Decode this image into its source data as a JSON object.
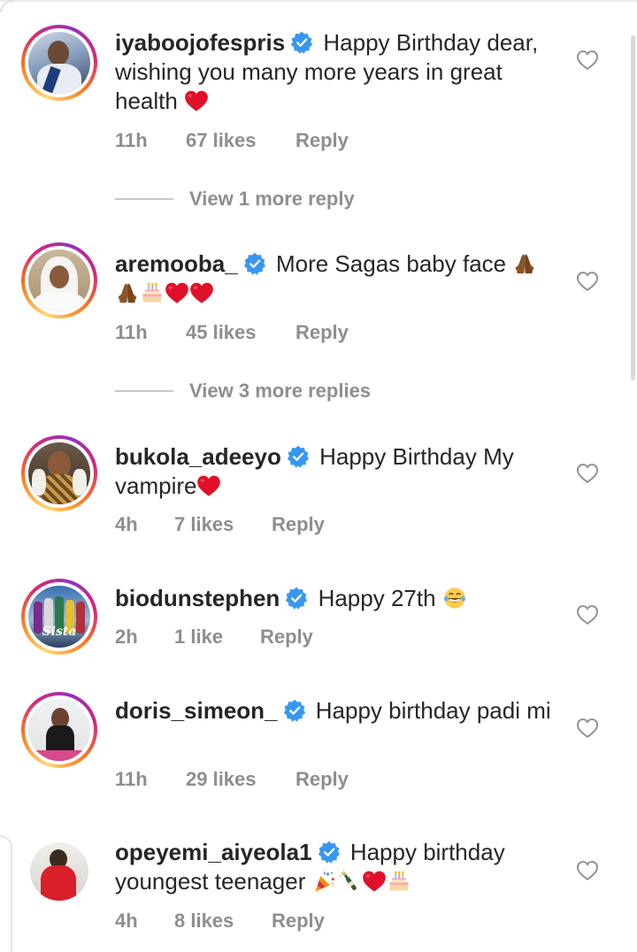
{
  "comments": [
    {
      "username": "iyaboojofespris",
      "text": "Happy Birthday dear, wishing you many more years in great health",
      "emojis": [
        "red-heart"
      ],
      "time": "11h",
      "likes": "67 likes",
      "reply": "Reply",
      "view_replies": "View 1 more reply"
    },
    {
      "username": "aremooba_",
      "text": "More Sagas baby face",
      "emojis": [
        "folded-hands",
        "folded-hands",
        "birthday-cake",
        "red-heart",
        "red-heart"
      ],
      "time": "11h",
      "likes": "45 likes",
      "reply": "Reply",
      "view_replies": "View 3 more replies"
    },
    {
      "username": "bukola_adeeyo",
      "text": "Happy Birthday My vampire",
      "emojis": [
        "red-heart"
      ],
      "time": "4h",
      "likes": "7 likes",
      "reply": "Reply"
    },
    {
      "username": "biodunstephen",
      "text": "Happy 27th",
      "emojis": [
        "face-with-tears-of-joy"
      ],
      "avatar_text": "Sista",
      "time": "2h",
      "likes": "1 like",
      "reply": "Reply"
    },
    {
      "username": "doris_simeon_",
      "text": "Happy birthday padi mi",
      "emojis": [],
      "time": "11h",
      "likes": "29 likes",
      "reply": "Reply"
    },
    {
      "username": "opeyemi_aiyeola1",
      "text": "Happy birthday youngest teenager",
      "emojis": [
        "party-popper",
        "champagne-bottle",
        "red-heart",
        "birthday-cake"
      ],
      "time": "4h",
      "likes": "8 likes",
      "reply": "Reply"
    }
  ],
  "colors": {
    "text": "#262626",
    "secondary": "#8e8e8e",
    "verified": "#3897f0",
    "heart": "#e0102a"
  },
  "icons": {
    "verified": "verified-badge-icon",
    "like": "heart-outline-icon"
  }
}
